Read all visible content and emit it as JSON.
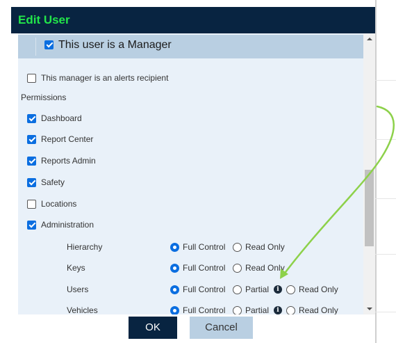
{
  "dialog": {
    "title": "Edit User",
    "manager_label": "This user is a Manager",
    "manager_checked": true,
    "alerts_label": "This manager is an alerts recipient",
    "alerts_checked": false,
    "permissions_title": "Permissions",
    "permissions": [
      {
        "label": "Dashboard",
        "checked": true
      },
      {
        "label": "Report Center",
        "checked": true
      },
      {
        "label": "Reports Admin",
        "checked": true
      },
      {
        "label": "Safety",
        "checked": true
      },
      {
        "label": "Locations",
        "checked": false
      },
      {
        "label": "Administration",
        "checked": true
      }
    ],
    "admin_rows": [
      {
        "label": "Hierarchy",
        "options": [
          "Full Control",
          "Read Only"
        ],
        "selected": "Full Control"
      },
      {
        "label": "Keys",
        "options": [
          "Full Control",
          "Read Only"
        ],
        "selected": "Full Control"
      },
      {
        "label": "Users",
        "options": [
          "Full Control",
          "Partial",
          "Read Only"
        ],
        "selected": "Full Control"
      },
      {
        "label": "Vehicles",
        "options": [
          "Full Control",
          "Partial",
          "Read Only"
        ],
        "selected": "Full Control"
      }
    ],
    "ok_label": "OK",
    "cancel_label": "Cancel"
  },
  "colors": {
    "title_bg": "#082441",
    "title_text": "#22e64a",
    "body_bg": "#e9f1f9",
    "header_bg": "#b9cfe2",
    "accent": "#0b6ee0",
    "annotation_arrow": "#8dd14a"
  },
  "icons": {
    "info": "info-icon",
    "annotation": "curved-arrow-annotation"
  }
}
